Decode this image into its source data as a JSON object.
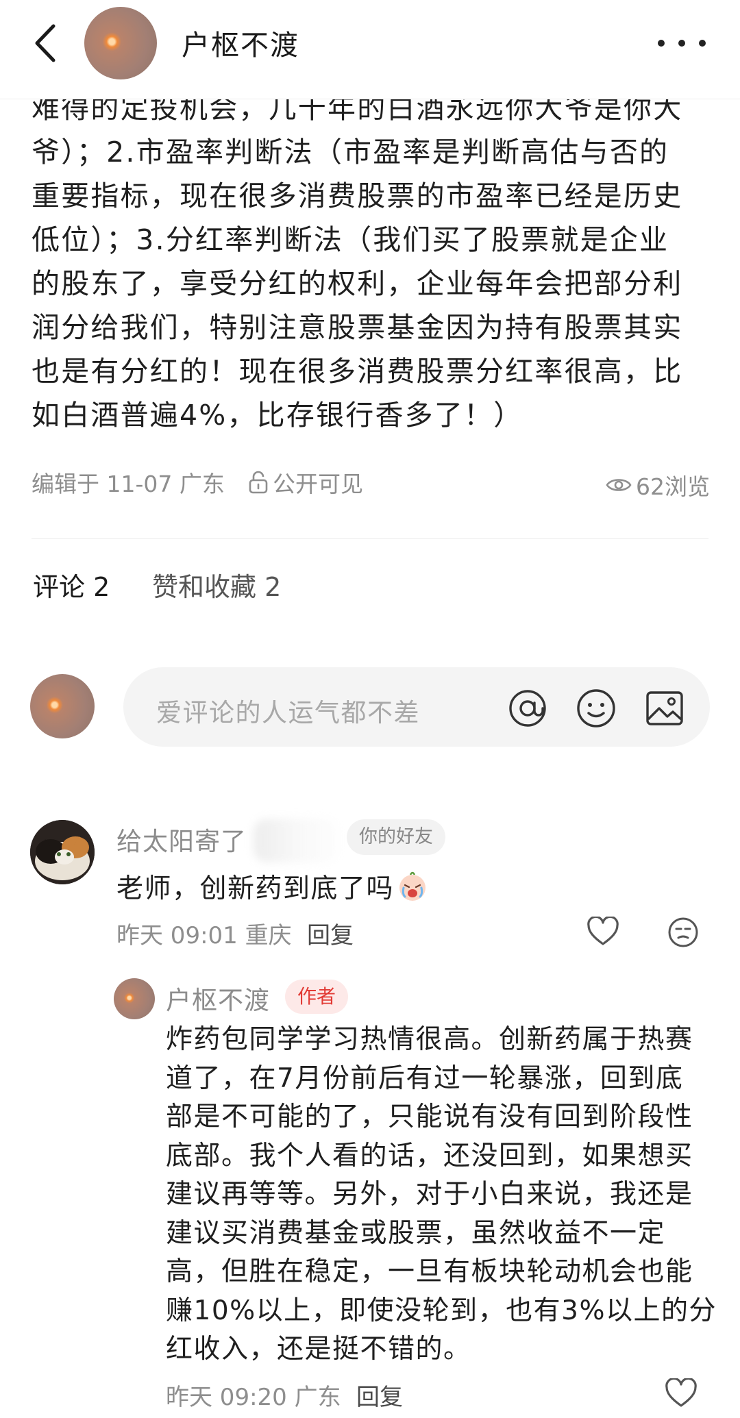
{
  "header": {
    "title": "户枢不渡",
    "back_icon": "chevron-left-icon",
    "more_icon": "more-horizontal-icon"
  },
  "post": {
    "lines": [
      "难得的定投机会，几十年的白酒永远你大爷是你大",
      "爷）；2.市盈率判断法（市盈率是判断高估与否的",
      "重要指标，现在很多消费股票的市盈率已经是历史",
      "低位）；3.分红率判断法（我们买了股票就是企业",
      "的股东了，享受分红的权利，企业每年会把部分利",
      "润分给我们，特别注意股票基金因为持有股票其实",
      "也是有分红的！现在很多消费股票分红率很高，比",
      "如白酒普遍4%，比存银行香多了！）"
    ],
    "edited": "编辑于 11-07 广东",
    "visibility": "公开可见",
    "views": "62浏览"
  },
  "tabs": {
    "comments": "评论 2",
    "likes": "赞和收藏 2"
  },
  "comment_input": {
    "placeholder": "爱评论的人运气都不差"
  },
  "comment": {
    "user": "给太阳寄了",
    "badge": "你的好友",
    "text": "老师，创新药到底了吗",
    "meta": "昨天 09:01 重庆",
    "reply_label": "回复"
  },
  "reply": {
    "user": "户枢不渡",
    "badge": "作者",
    "lines": [
      "炸药包同学学习热情很高。创新药属于热赛",
      "道了，在7月份前后有过一轮暴涨，回到底",
      "部是不可能的了，只能说有没有回到阶段性",
      "底部。我个人看的话，还没回到，如果想买",
      "建议再等等。另外，对于小白来说，我还是",
      "建议买消费基金或股票，虽然收益不一定",
      "高，但胜在稳定，一旦有板块轮动机会也能",
      "赚10%以上，即使没轮到，也有3%以上的分",
      "红收入，还是挺不错的。"
    ],
    "meta": "昨天 09:20 广东",
    "reply_label": "回复"
  },
  "colors": {
    "author_badge_text": "#e23b35",
    "author_badge_bg": "#fde9e8",
    "muted_text": "#8e8e8e"
  }
}
